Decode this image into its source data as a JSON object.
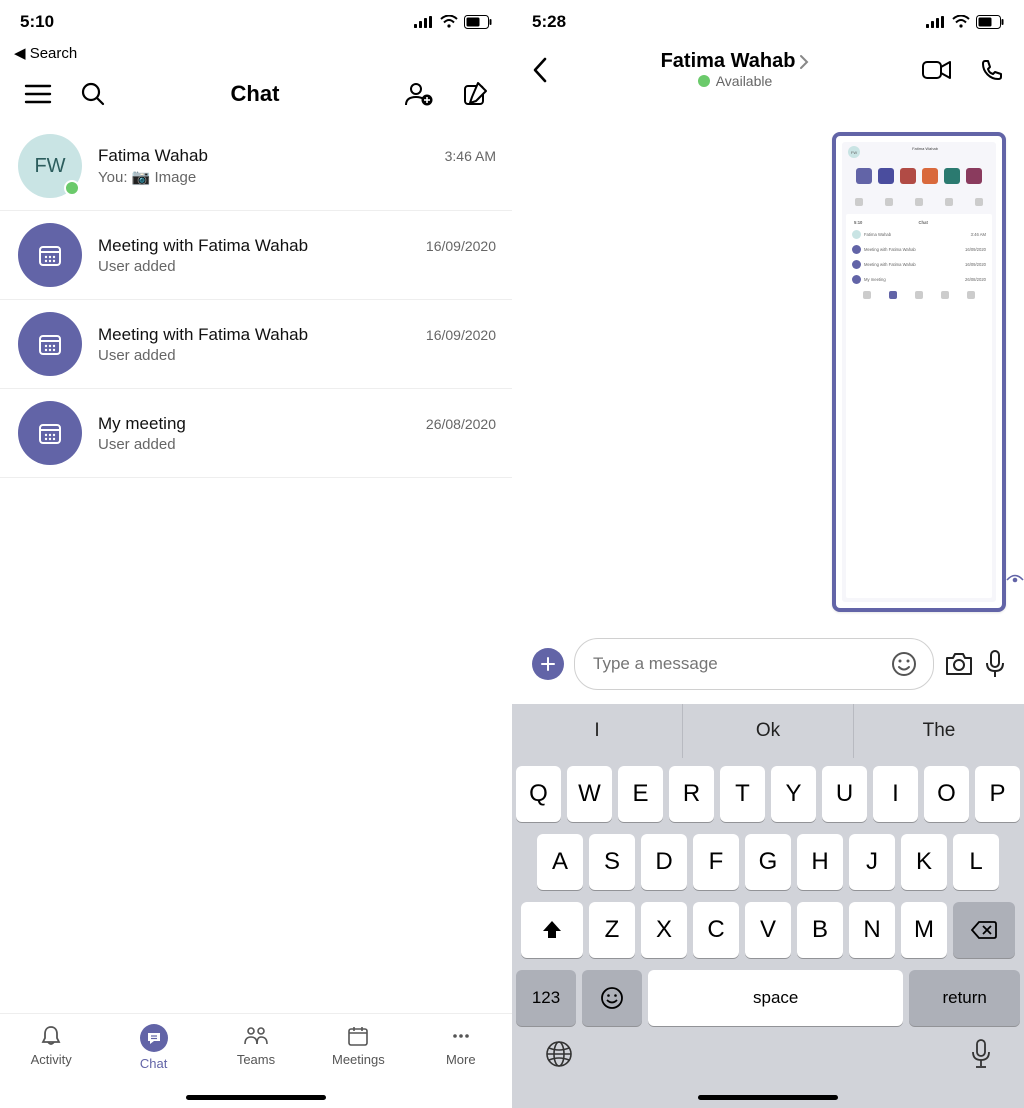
{
  "left": {
    "status": {
      "time": "5:10"
    },
    "back_search": "◀ Search",
    "title": "Chat",
    "chats": [
      {
        "type": "user",
        "initials": "FW",
        "name": "Fatima Wahab",
        "subtitle": "You: 📷 Image",
        "time": "3:46 AM",
        "presence": true
      },
      {
        "type": "meeting",
        "name": "Meeting with Fatima Wahab",
        "subtitle": "User added",
        "time": "16/09/2020"
      },
      {
        "type": "meeting",
        "name": "Meeting with Fatima Wahab",
        "subtitle": "User added",
        "time": "16/09/2020"
      },
      {
        "type": "meeting",
        "name": "My meeting",
        "subtitle": "User added",
        "time": "26/08/2020"
      }
    ],
    "tabs": [
      "Activity",
      "Chat",
      "Teams",
      "Meetings",
      "More"
    ],
    "active_tab_index": 1
  },
  "right": {
    "status": {
      "time": "5:28"
    },
    "title": "Fatima Wahab",
    "presence_label": "Available",
    "input_placeholder": "Type a message",
    "suggestions": [
      "I",
      "Ok",
      "The"
    ],
    "rows": {
      "r1": [
        "Q",
        "W",
        "E",
        "R",
        "T",
        "Y",
        "U",
        "I",
        "O",
        "P"
      ],
      "r2": [
        "A",
        "S",
        "D",
        "F",
        "G",
        "H",
        "J",
        "K",
        "L"
      ],
      "r3": [
        "Z",
        "X",
        "C",
        "V",
        "B",
        "N",
        "M"
      ]
    },
    "num_key": "123",
    "space_key": "space",
    "return_key": "return",
    "thumb": {
      "sb_time": "5:10",
      "title": "Chat",
      "rows": [
        {
          "n": "Fatima Wahab",
          "t": "3:46 AM"
        },
        {
          "n": "Meeting with Fatima Wahab",
          "t": "16/09/2020"
        },
        {
          "n": "Meeting with Fatima Wahab",
          "t": "16/09/2020"
        },
        {
          "n": "My meeting",
          "t": "26/08/2020"
        }
      ]
    }
  }
}
